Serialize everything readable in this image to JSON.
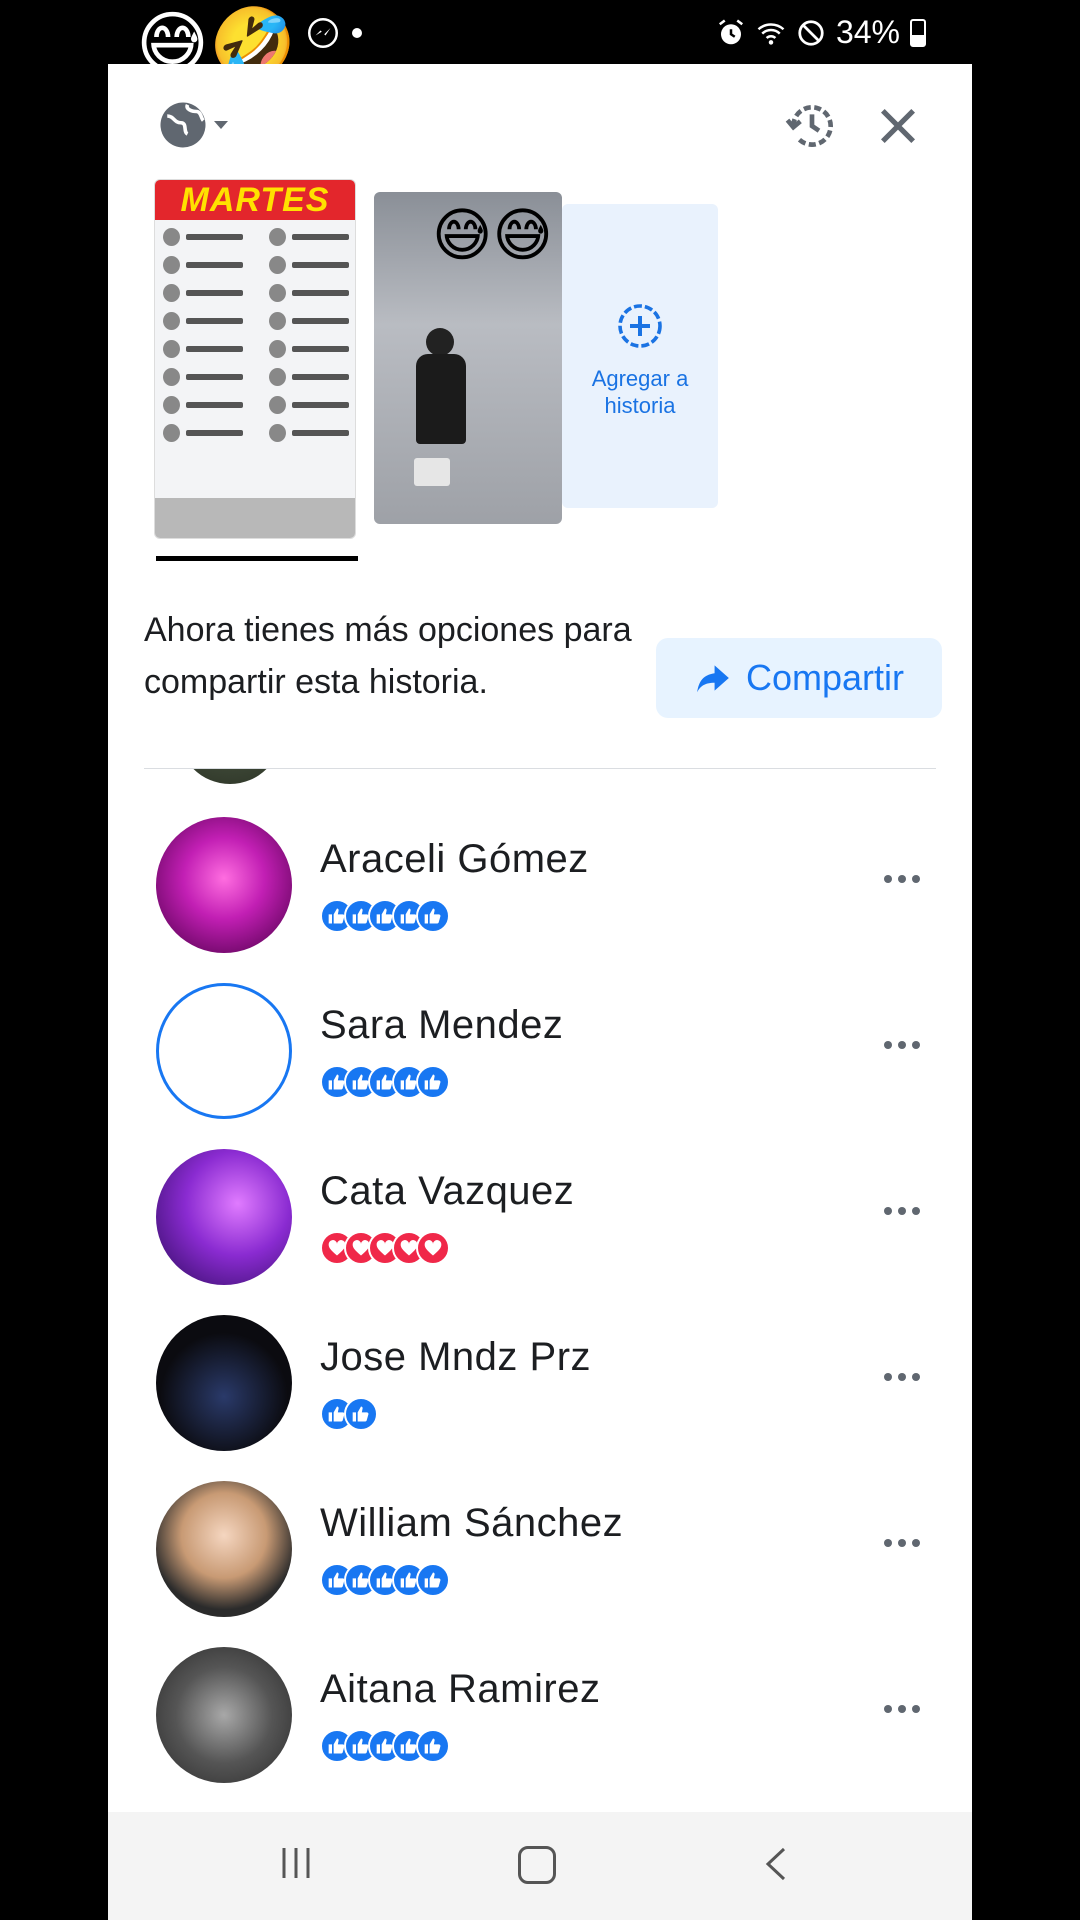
{
  "status_bar": {
    "emojis": "😅🤣",
    "battery_percent": "34%"
  },
  "stories": {
    "story1_banner": "MARTES",
    "story2_emojis": "😅😅",
    "add_story_label_line1": "Agregar a",
    "add_story_label_line2": "historia"
  },
  "share": {
    "message": "Ahora tienes más opciones para compartir esta historia.",
    "button_label": "Compartir"
  },
  "viewers": [
    {
      "name": "Araceli Gómez",
      "reactions": [
        "like",
        "like",
        "like",
        "like",
        "like"
      ]
    },
    {
      "name": "Sara Mendez",
      "reactions": [
        "like",
        "like",
        "like",
        "like",
        "like"
      ]
    },
    {
      "name": "Cata Vazquez",
      "reactions": [
        "love",
        "love",
        "love",
        "love",
        "love"
      ]
    },
    {
      "name": "Jose Mndz Prz",
      "reactions": [
        "like",
        "like"
      ]
    },
    {
      "name": "William Sánchez",
      "reactions": [
        "like",
        "like",
        "like",
        "like",
        "like"
      ]
    },
    {
      "name": "Aitana Ramirez",
      "reactions": [
        "like",
        "like",
        "like",
        "like",
        "like"
      ]
    }
  ],
  "icons": {
    "privacy": "globe-icon",
    "history": "history-icon",
    "close": "close-icon",
    "add": "add-circle-icon",
    "share": "share-arrow-icon",
    "more": "more-horizontal-icon"
  },
  "colors": {
    "accent": "#1877f2",
    "like": "#1877f2",
    "love": "#f02849",
    "add_story_bg": "#e9f2fd"
  }
}
